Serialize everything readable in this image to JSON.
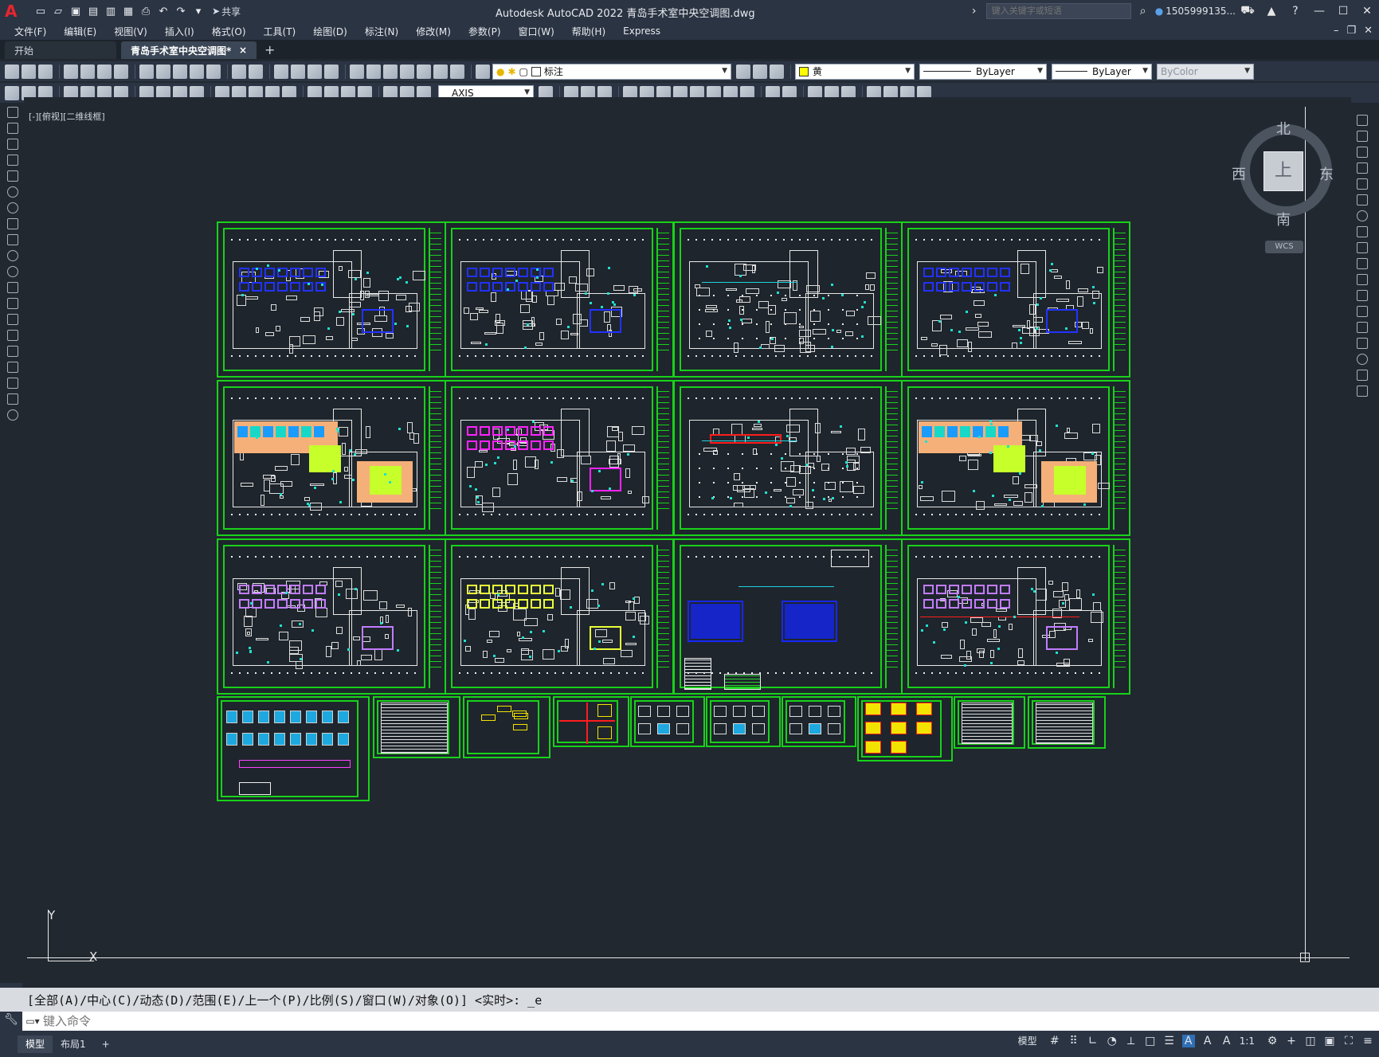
{
  "app": {
    "title": "Autodesk AutoCAD 2022    青岛手术室中央空调图.dwg",
    "logo": "A",
    "share_label": "共享",
    "search_placeholder": "键入关键字或短语",
    "user": "1505999135...",
    "help": "?"
  },
  "menu": {
    "items": [
      "文件(F)",
      "编辑(E)",
      "视图(V)",
      "插入(I)",
      "格式(O)",
      "工具(T)",
      "绘图(D)",
      "标注(N)",
      "修改(M)",
      "参数(P)",
      "窗口(W)",
      "帮助(H)",
      "Express"
    ]
  },
  "tabs": {
    "start": "开始",
    "active": "青岛手术室中央空调图*",
    "close": "×",
    "add": "+"
  },
  "toolbar": {
    "layer": "标注",
    "color": "黄",
    "color_hex": "#ffff00",
    "linetype": "ByLayer",
    "lineweight": "ByLayer",
    "plotstyle": "ByColor",
    "dimstyle": "AXIS"
  },
  "viewport": {
    "label": "[-][俯视][二维线框]"
  },
  "viewcube": {
    "north": "北",
    "south": "南",
    "east": "东",
    "west": "西",
    "face": "上",
    "wcs": "WCS"
  },
  "ucs": {
    "x": "X",
    "y": "Y"
  },
  "command": {
    "history": "[全部(A)/中心(C)/动态(D)/范围(E)/上一个(P)/比例(S)/窗口(W)/对象(O)] <实时>: _e",
    "placeholder": "键入命令"
  },
  "status": {
    "model_tab": "模型",
    "layout_tab": "布局1",
    "add_tab": "+",
    "model_label": "模型",
    "scale": "1:1"
  },
  "colors": {
    "frame_green": "#18d21a",
    "canvas_bg": "#212830",
    "ui_bg": "#2b3443"
  }
}
